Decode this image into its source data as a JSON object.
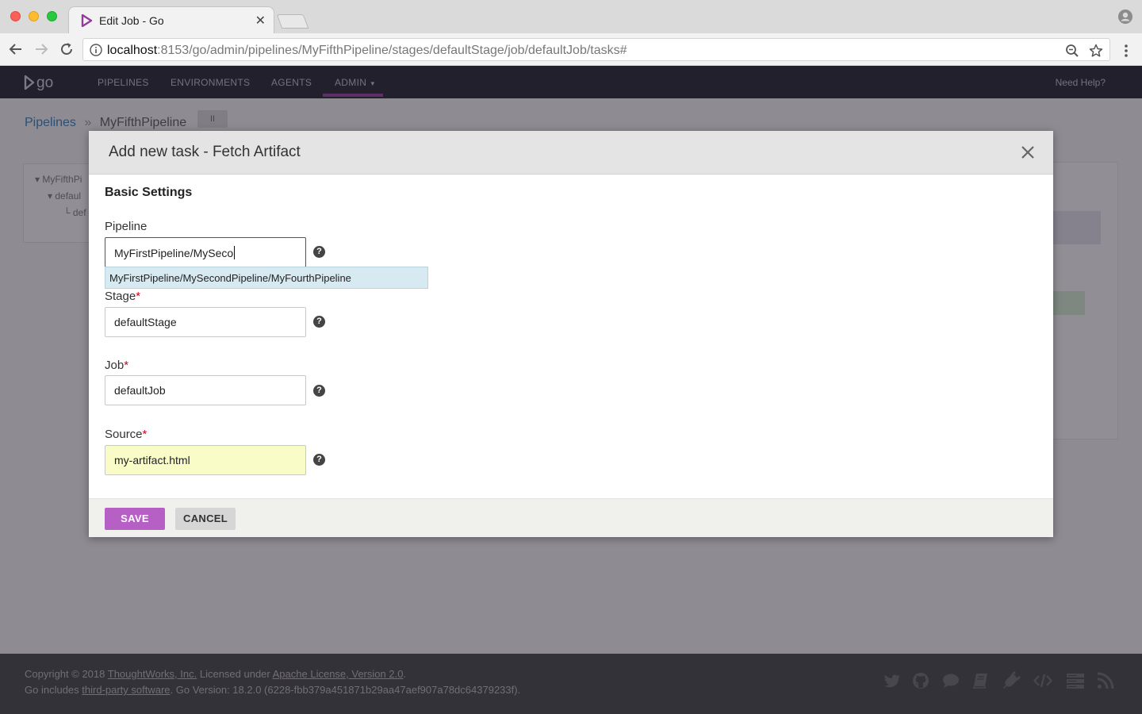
{
  "browser": {
    "tab_title": "Edit Job - Go",
    "url_host": "localhost",
    "url_rest": ":8153/go/admin/pipelines/MyFifthPipeline/stages/defaultStage/job/defaultJob/tasks#"
  },
  "app": {
    "logo_text": "go",
    "nav": {
      "pipelines": "PIPELINES",
      "environments": "ENVIRONMENTS",
      "agents": "AGENTS",
      "admin": "ADMIN"
    },
    "need_help": "Need Help?",
    "breadcrumb": {
      "root": "Pipelines",
      "separator": "»",
      "current": "MyFifthPipeline",
      "pause": "II"
    },
    "tree": {
      "pipeline": "MyFifthPi",
      "stage": "defaul",
      "job": "def"
    }
  },
  "modal": {
    "title": "Add new task - Fetch Artifact",
    "section_title": "Basic Settings",
    "fields": {
      "pipeline": {
        "label": "Pipeline",
        "value": "MyFirstPipeline/MySeco"
      },
      "stage": {
        "label": "Stage",
        "required": "*",
        "value": "defaultStage"
      },
      "job": {
        "label": "Job",
        "required": "*",
        "value": "defaultJob"
      },
      "source": {
        "label": "Source",
        "required": "*",
        "value": "my-artifact.html"
      }
    },
    "autocomplete_option": "MyFirstPipeline/MySecondPipeline/MyFourthPipeline",
    "help_glyph": "?",
    "save_label": "SAVE",
    "cancel_label": "CANCEL"
  },
  "footer": {
    "copyright_prefix": "Copyright © 2018 ",
    "company_link": "ThoughtWorks, Inc.",
    "licensed_text": " Licensed under ",
    "license_link": "Apache License, Version 2.0",
    "licensed_suffix": ".",
    "includes_prefix": "Go includes ",
    "third_party_link": "third-party software",
    "version_text": ". Go Version: 18.2.0 (6228-fbb379a451871b29aa47aef907a78dc64379233f)."
  },
  "colors": {
    "brand_purple": "#943a9e",
    "save_button": "#b660c6",
    "required": "#d0021b",
    "autocomplete_highlight": "#d7eaf2",
    "source_highlight": "#fafcc7"
  },
  "icons": {
    "social": [
      "twitter-icon",
      "github-icon",
      "chat-icon",
      "book-icon",
      "plugin-icon",
      "code-icon",
      "server-icon",
      "rss-icon"
    ]
  }
}
